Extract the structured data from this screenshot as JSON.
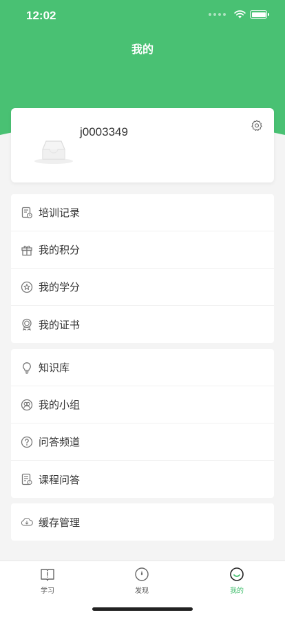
{
  "status_bar": {
    "time": "12:02"
  },
  "header": {
    "title": "我的"
  },
  "profile": {
    "username": "j0003349"
  },
  "menu_group_1": [
    {
      "label": "培训记录",
      "icon": "training-record-icon"
    },
    {
      "label": "我的积分",
      "icon": "gift-icon"
    },
    {
      "label": "我的学分",
      "icon": "star-badge-icon"
    },
    {
      "label": "我的证书",
      "icon": "certificate-icon"
    }
  ],
  "menu_group_2": [
    {
      "label": "知识库",
      "icon": "lightbulb-icon"
    },
    {
      "label": "我的小组",
      "icon": "group-icon"
    },
    {
      "label": "问答频道",
      "icon": "question-icon"
    },
    {
      "label": "课程问答",
      "icon": "course-qa-icon"
    }
  ],
  "menu_group_3": [
    {
      "label": "缓存管理",
      "icon": "cloud-download-icon"
    }
  ],
  "tabbar": {
    "tabs": [
      {
        "label": "学习",
        "icon": "book-icon"
      },
      {
        "label": "发现",
        "icon": "compass-icon"
      },
      {
        "label": "我的",
        "icon": "smile-icon",
        "active": true
      }
    ]
  },
  "colors": {
    "accent": "#49c173",
    "background": "#f4f4f4"
  }
}
